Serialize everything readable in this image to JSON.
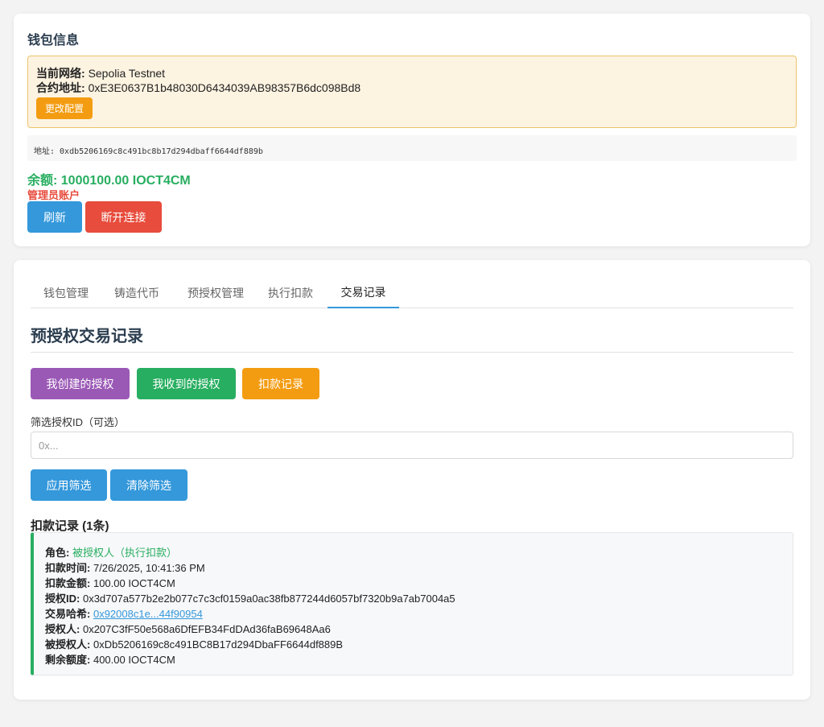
{
  "wallet": {
    "title": "钱包信息",
    "network_label": "当前网络:",
    "network_value": "Sepolia Testnet",
    "contract_label": "合约地址:",
    "contract_value": "0xE3E0637B1b48030D6434039AB98357B6dc098Bd8",
    "config_button": "更改配置",
    "address_text": "地址: 0xdb5206169c8c491bc8b17d294dbaff6644df889b",
    "balance_text": "余额: 1000100.00 IOCT4CM",
    "admin_label": "管理员账户",
    "refresh_button": "刷新",
    "disconnect_button": "断开连接"
  },
  "tabs": [
    {
      "label": "钱包管理",
      "active": false
    },
    {
      "label": "铸造代币",
      "active": false
    },
    {
      "label": "预授权管理",
      "active": false
    },
    {
      "label": "执行扣款",
      "active": false
    },
    {
      "label": "交易记录",
      "active": true
    }
  ],
  "section": {
    "title": "预授权交易记录",
    "created_button": "我创建的授权",
    "received_button": "我收到的授权",
    "deduction_button": "扣款记录",
    "filter_label": "筛选授权ID（可选）",
    "filter_placeholder": "0x...",
    "apply_button": "应用筛选",
    "clear_button": "清除筛选",
    "records_title": "扣款记录 (1条)"
  },
  "record": {
    "role_label": "角色:",
    "role_value": "被授权人（执行扣款）",
    "time_label": "扣款时间:",
    "time_value": "7/26/2025, 10:41:36 PM",
    "amount_label": "扣款金额:",
    "amount_value": "100.00 IOCT4CM",
    "auth_id_label": "授权ID:",
    "auth_id_value": "0x3d707a577b2e2b077c7c3cf0159a0ac38fb877244d6057bf7320b9a7ab7004a5",
    "tx_hash_label": "交易哈希:",
    "tx_hash_value": "0x92008c1e...44f90954",
    "grantor_label": "授权人:",
    "grantor_value": "0x207C3fF50e568a6DfEFB34FdDAd36faB69648Aa6",
    "grantee_label": "被授权人:",
    "grantee_value": "0xDb5206169c8c491BC8B17d294DbaFF6644df889B",
    "remaining_label": "剩余额度:",
    "remaining_value": "400.00 IOCT4CM"
  },
  "colors": {
    "primary": "#3498db",
    "success": "#27ae60",
    "warning": "#f39c12",
    "danger": "#e74c3c",
    "purple": "#9b59b6"
  }
}
